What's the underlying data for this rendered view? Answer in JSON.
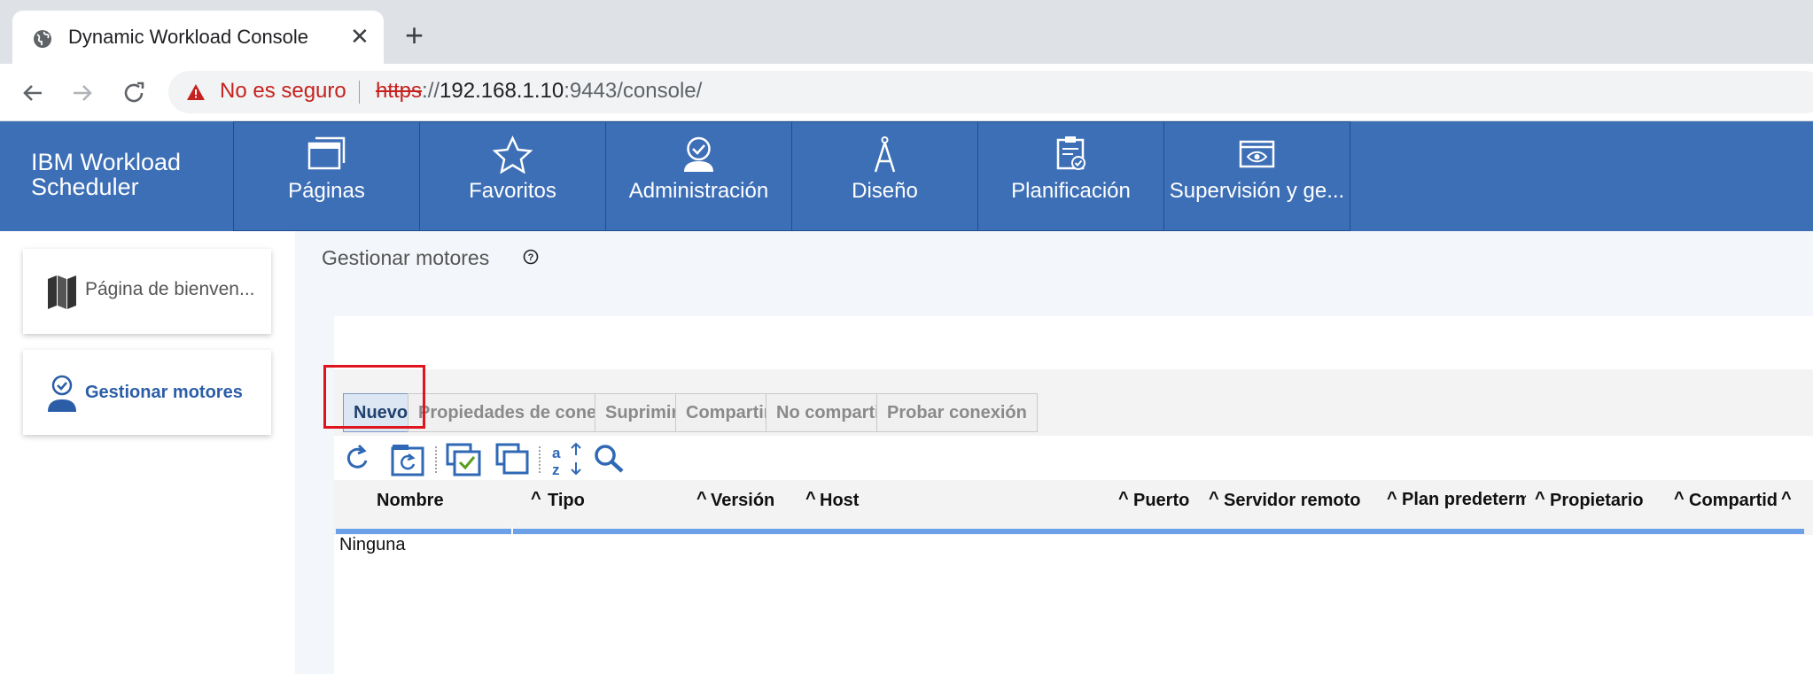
{
  "browser": {
    "tab_title": "Dynamic Workload Console",
    "insecure_label": "No es seguro",
    "url_scheme": "https",
    "url_rest": "://",
    "url_host": "192.168.1.10",
    "url_tail": ":9443/console/",
    "icons": [
      "globe-icon",
      "close-icon",
      "plus-icon",
      "back-icon",
      "forward-icon",
      "reload-icon",
      "warning-icon"
    ]
  },
  "header": {
    "brand_line1": "IBM Workload",
    "brand_line2": "Scheduler",
    "nav": [
      {
        "label": "Páginas",
        "icon": "pages-icon"
      },
      {
        "label": "Favoritos",
        "icon": "star-icon"
      },
      {
        "label": "Administración",
        "icon": "admin-icon"
      },
      {
        "label": "Diseño",
        "icon": "compass-icon"
      },
      {
        "label": "Planificación",
        "icon": "clipboard-icon"
      },
      {
        "label": "Supervisión y ge...",
        "icon": "monitor-icon"
      }
    ],
    "color": "#3d6fb6"
  },
  "sidebar": {
    "items": [
      {
        "label": "Página de bienven...",
        "icon": "map-icon"
      },
      {
        "label": "Gestionar motores",
        "icon": "engine-user-icon"
      }
    ]
  },
  "main": {
    "title": "Gestionar motores",
    "actions": {
      "nuevo": "Nuevo",
      "propiedades": "Propiedades de conexión",
      "suprimir": "Suprimir",
      "compartir": "Compartir",
      "no_compartir": "No compartir",
      "probar": "Probar conexión"
    },
    "toolbar_icons": [
      "refresh-icon",
      "refresh-frame-icon",
      "select-all-icon",
      "deselect-all-icon",
      "sort-icon",
      "search-icon"
    ],
    "columns": {
      "nombre": "Nombre",
      "tipo": "Tipo",
      "version": "Versión",
      "host": "Host",
      "puerto": "Puerto",
      "servidor": "Servidor remoto",
      "plan": "Plan predeterminado",
      "propietario": "Propietario",
      "compartido": "Compartid"
    },
    "empty_text": "Ninguna",
    "highlight_color": "#e0141e"
  }
}
